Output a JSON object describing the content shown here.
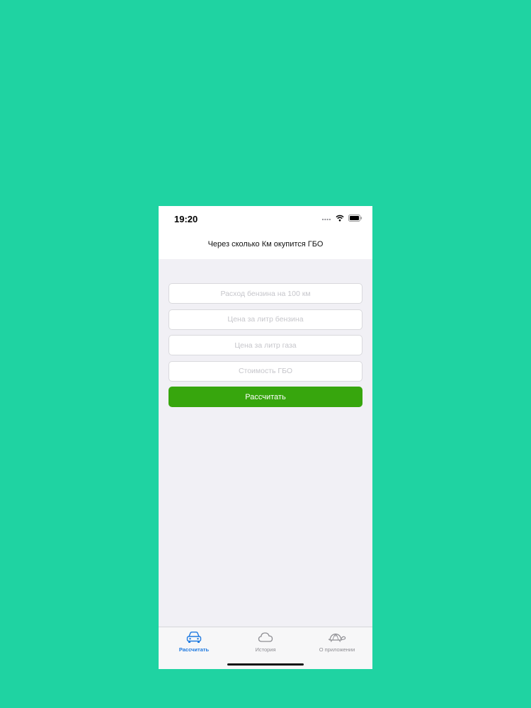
{
  "status": {
    "time": "19:20"
  },
  "nav": {
    "title": "Через сколько Км окупится ГБО"
  },
  "form": {
    "fuel_consumption_placeholder": "Расход бензина на 100 км",
    "petrol_price_placeholder": "Цена за литр бензина",
    "gas_price_placeholder": "Цена за литр газа",
    "lpg_cost_placeholder": "Стоимость ГБО",
    "calculate_label": "Рассчитать"
  },
  "tabs": [
    {
      "label": "Рассчитать",
      "icon": "car-icon",
      "active": true
    },
    {
      "label": "История",
      "icon": "cloud-icon",
      "active": false
    },
    {
      "label": "О приложении",
      "icon": "turtle-icon",
      "active": false
    }
  ],
  "colors": {
    "background": "#1fd3a2",
    "accent_button": "#37a60d",
    "active_tab": "#1f7ae0",
    "inactive_tab": "#8e8e93"
  }
}
